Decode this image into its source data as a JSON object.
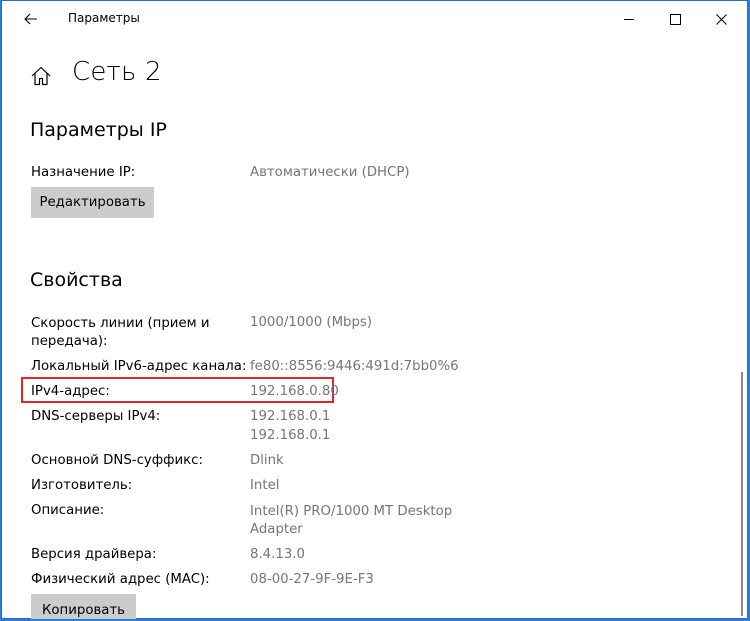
{
  "window": {
    "title": "Параметры"
  },
  "header": {
    "title": "Сеть 2"
  },
  "ip_settings": {
    "heading": "Параметры IP",
    "assignment_label": "Назначение IP:",
    "assignment_value": "Автоматически (DHCP)",
    "edit_button": "Редактировать"
  },
  "properties": {
    "heading": "Свойства",
    "link_speed_label_1": "Скорость линии (прием и",
    "link_speed_label_2": "передача):",
    "link_speed_value": "1000/1000 (Mbps)",
    "ipv6_label": "Локальный IPv6-адрес канала:",
    "ipv6_value": "fe80::8556:9446:491d:7bb0%6",
    "ipv4_label": "IPv4-адрес:",
    "ipv4_value": "192.168.0.80",
    "dns_label": "DNS-серверы IPv4:",
    "dns_value_1": "192.168.0.1",
    "dns_value_2": "192.168.0.1",
    "dns_suffix_label": "Основной DNS-суффикс:",
    "dns_suffix_value": "Dlink",
    "manufacturer_label": "Изготовитель:",
    "manufacturer_value": "Intel",
    "description_label": "Описание:",
    "description_value_1": "Intel(R) PRO/1000 MT Desktop",
    "description_value_2": "Adapter",
    "driver_label": "Версия драйвера:",
    "driver_value": "8.4.13.0",
    "mac_label": "Физический адрес (MAC):",
    "mac_value": "08-00-27-9F-9E-F3",
    "copy_button": "Копировать"
  },
  "colors": {
    "highlight": "#e0262b",
    "button_bg": "#cccccc",
    "value_text": "#767676",
    "desktop": "#2c7fd9"
  },
  "icons": [
    "back-arrow-icon",
    "minimize-icon",
    "maximize-icon",
    "close-icon",
    "home-icon"
  ]
}
